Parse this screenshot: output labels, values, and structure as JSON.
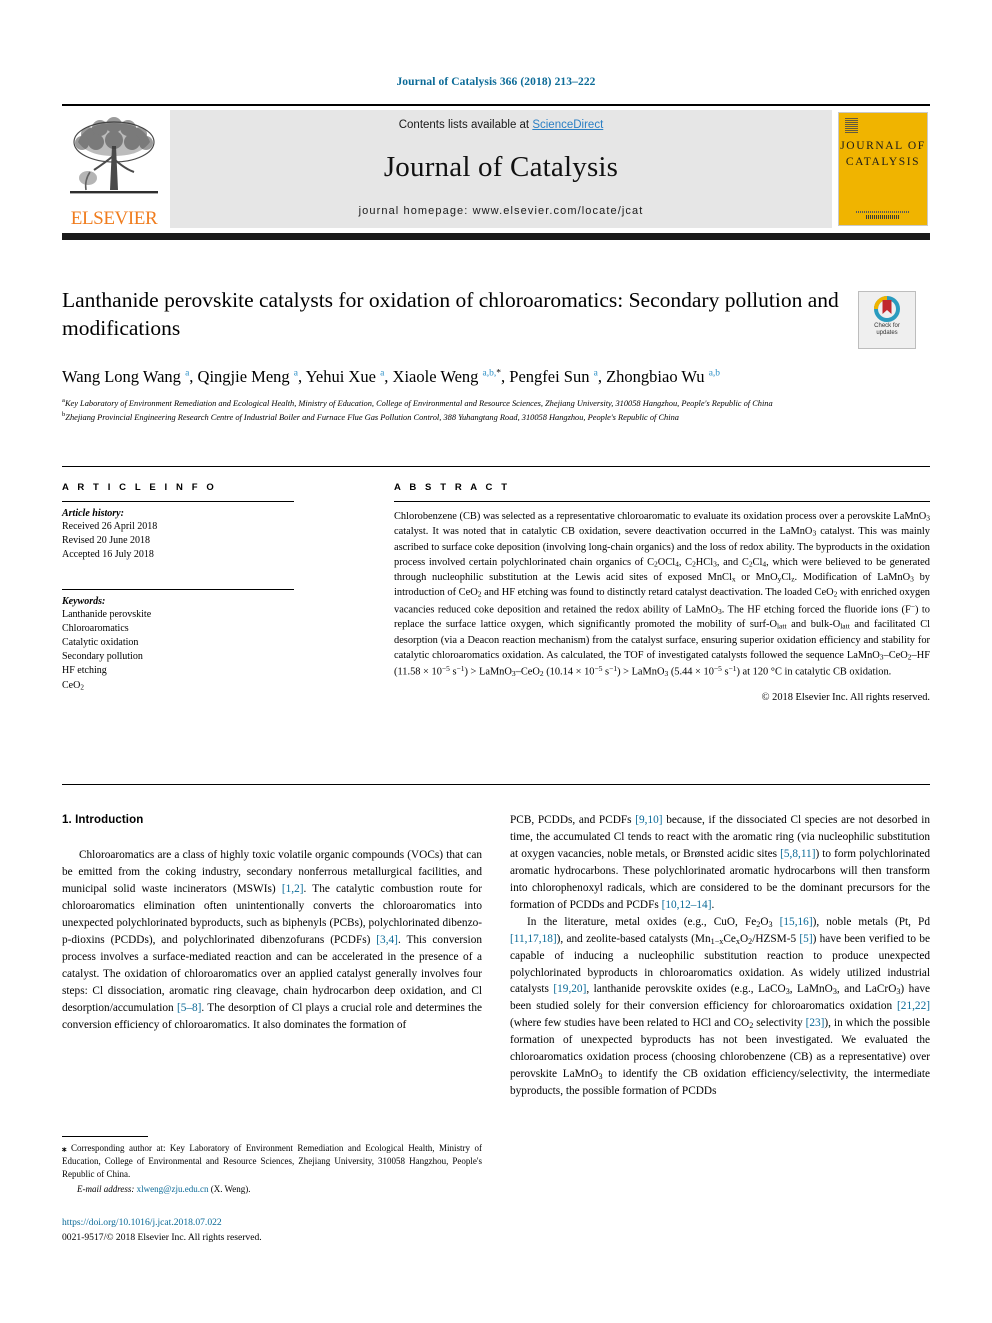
{
  "running_head": "Journal of Catalysis 366 (2018) 213–222",
  "masthead": {
    "contents_prefix": "Contents lists available at ",
    "sciencedirect": "ScienceDirect",
    "journal_name": "Journal of Catalysis",
    "homepage": "journal homepage: www.elsevier.com/locate/jcat",
    "publisher_wordmark": "ELSEVIER",
    "cover_title_line1": "JOURNAL OF",
    "cover_title_line2": "CATALYSIS",
    "accent_color": "#0b6a97",
    "cover_color": "#f0b400",
    "elsevier_orange": "#f07c1d"
  },
  "crossmark": {
    "line1": "Check for",
    "line2": "updates"
  },
  "title": "Lanthanide perovskite catalysts for oxidation of chloroaromatics: Secondary pollution and modifications",
  "authors_html": "Wang Long Wang <sup>a</sup>, Qingjie Meng <sup>a</sup>, Yehui Xue <sup>a</sup>, Xiaole Weng <sup>a,b,</sup><sup class=\"star\">*</sup>, Pengfei Sun <sup>a</sup>, Zhongbiao Wu <sup>a,b</sup>",
  "affiliations": [
    "Key Laboratory of Environment Remediation and Ecological Health, Ministry of Education, College of Environmental and Resource Sciences, Zhejiang University, 310058 Hangzhou, People's Republic of China",
    "Zhejiang Provincial Engineering Research Centre of Industrial Boiler and Furnace Flue Gas Pollution Control, 388 Yuhangtang Road, 310058 Hangzhou, People's Republic of China"
  ],
  "article_info": {
    "section_label": "A R T I C L E   I N F O",
    "history_label": "Article history:",
    "history": [
      "Received 26 April 2018",
      "Revised 20 June 2018",
      "Accepted 16 July 2018"
    ],
    "keywords_label": "Keywords:",
    "keywords": [
      "Lanthanide perovskite",
      "Chloroaromatics",
      "Catalytic oxidation",
      "Secondary pollution",
      "HF etching",
      "CeO2"
    ]
  },
  "abstract": {
    "section_label": "A B S T R A C T",
    "text_html": "Chlorobenzene (CB) was selected as a representative chloroaromatic to evaluate its oxidation process over a perovskite LaMnO<span class=\"subsc\">3</span> catalyst. It was noted that in catalytic CB oxidation, severe deactivation occurred in the LaMnO<span class=\"subsc\">3</span> catalyst. This was mainly ascribed to surface coke deposition (involving long-chain organics) and the loss of redox ability. The byproducts in the oxidation process involved certain polychlorinated chain organics of C<span class=\"subsc\">2</span>OCl<span class=\"subsc\">4</span>, C<span class=\"subsc\">2</span>HCl<span class=\"subsc\">3</span>, and C<span class=\"subsc\">2</span>Cl<span class=\"subsc\">4</span>, which were believed to be generated through nucleophilic substitution at the Lewis acid sites of exposed MnCl<span class=\"subsc\">x</span> or MnO<span class=\"subsc\">y</span>Cl<span class=\"subsc\">z</span>. Modification of LaMnO<span class=\"subsc\">3</span> by introduction of CeO<span class=\"subsc\">2</span> and HF etching was found to distinctly retard catalyst deactivation. The loaded CeO<span class=\"subsc\">2</span> with enriched oxygen vacancies reduced coke deposition and retained the redox ability of LaMnO<span class=\"subsc\">3</span>. The HF etching forced the fluoride ions (F<span class=\"supsc\">−</span>) to replace the surface lattice oxygen, which significantly promoted the mobility of surf-O<span class=\"subsc\">latt</span> and bulk-O<span class=\"subsc\">latt</span> and facilitated Cl desorption (via a Deacon reaction mechanism) from the catalyst surface, ensuring superior oxidation efficiency and stability for catalytic chloroaromatics oxidation. As calculated, the TOF of investigated catalysts followed the sequence LaMnO<span class=\"subsc\">3</span>–CeO<span class=\"subsc\">2</span>–HF (11.58 × 10<span class=\"supsc\">−5</span> s<span class=\"supsc\">−1</span>) > LaMnO<span class=\"subsc\">3</span>–CeO<span class=\"subsc\">2</span> (10.14 × 10<span class=\"supsc\">−5</span> s<span class=\"supsc\">−1</span>) > LaMnO<span class=\"subsc\">3</span> (5.44 × 10<span class=\"supsc\">−5</span> s<span class=\"supsc\">−1</span>) at 120 °C in catalytic CB oxidation.",
    "copyright": "© 2018 Elsevier Inc. All rights reserved."
  },
  "body": {
    "section_heading": "1. Introduction",
    "left_paragraphs_html": [
      "Chloroaromatics are a class of highly toxic volatile organic compounds (VOCs) that can be emitted from the coking industry, secondary nonferrous metallurgical facilities, and municipal solid waste incinerators (MSWIs) <span class=\"ref\">[1,2]</span>. The catalytic combustion route for chloroaromatics elimination often unintentionally converts the chloroaromatics into unexpected polychlorinated byproducts, such as biphenyls (PCBs), polychlorinated dibenzo-p-dioxins (PCDDs), and polychlorinated dibenzofurans (PCDFs) <span class=\"ref\">[3,4]</span>. This conversion process involves a surface-mediated reaction and can be accelerated in the presence of a catalyst. The oxidation of chloroaromatics over an applied catalyst generally involves four steps: Cl dissociation, aromatic ring cleavage, chain hydrocarbon deep oxidation, and Cl desorption/accumulation <span class=\"ref\">[5–8]</span>. The desorption of Cl plays a crucial role and determines the conversion efficiency of chloroaromatics. It also dominates the formation of"
    ],
    "right_paragraphs_html": [
      "PCB, PCDDs, and PCDFs <span class=\"ref\">[9,10]</span> because, if the dissociated Cl species are not desorbed in time, the accumulated Cl tends to react with the aromatic ring (via nucleophilic substitution at oxygen vacancies, noble metals, or Brønsted acidic sites <span class=\"ref\">[5,8,11]</span>) to form polychlorinated aromatic hydrocarbons. These polychlorinated aromatic hydrocarbons will then transform into chlorophenoxyl radicals, which are considered to be the dominant precursors for the formation of PCDDs and PCDFs <span class=\"ref\">[10,12–14]</span>.",
      "In the literature, metal oxides (e.g., CuO, Fe<span class=\"subsc\">2</span>O<span class=\"subsc\">3</span> <span class=\"ref\">[15,16]</span>), noble metals (Pt, Pd <span class=\"ref\">[11,17,18]</span>), and zeolite-based catalysts (Mn<span class=\"subsc\">1−x</span>Ce<span class=\"subsc\">x</span>O<span class=\"subsc\">2</span>/HZSM-5 <span class=\"ref\">[5]</span>) have been verified to be capable of inducing a nucleophilic substitution reaction to produce unexpected polychlorinated byproducts in chloroaromatics oxidation. As widely utilized industrial catalysts <span class=\"ref\">[19,20]</span>, lanthanide perovskite oxides (e.g., LaCO<span class=\"subsc\">3</span>, LaMnO<span class=\"subsc\">3</span>, and LaCrO<span class=\"subsc\">3</span>) have been studied solely for their conversion efficiency for chloroaromatics oxidation <span class=\"ref\">[21,22]</span> (where few studies have been related to HCl and CO<span class=\"subsc\">2</span> selectivity <span class=\"ref\">[23]</span>), in which the possible formation of unexpected byproducts has not been investigated. We evaluated the chloroaromatics oxidation process (choosing chlorobenzene (CB) as a representative) over perovskite LaMnO<span class=\"subsc\">3</span> to identify the CB oxidation efficiency/selectivity, the intermediate byproducts, the possible formation of PCDDs"
    ]
  },
  "footnotes": {
    "corresponding_html": "<b>⁎</b> Corresponding author at: Key Laboratory of Environment Remediation and Ecological Health, Ministry of Education, College of Environmental and Resource Sciences, Zhejiang University, 310058 Hangzhou, People's Republic of China.",
    "email_label": "E-mail address:",
    "email": "xlweng@zju.edu.cn",
    "email_suffix": "(X. Weng).",
    "doi": "https://doi.org/10.1016/j.jcat.2018.07.022",
    "issn_line": "0021-9517/© 2018 Elsevier Inc. All rights reserved."
  }
}
